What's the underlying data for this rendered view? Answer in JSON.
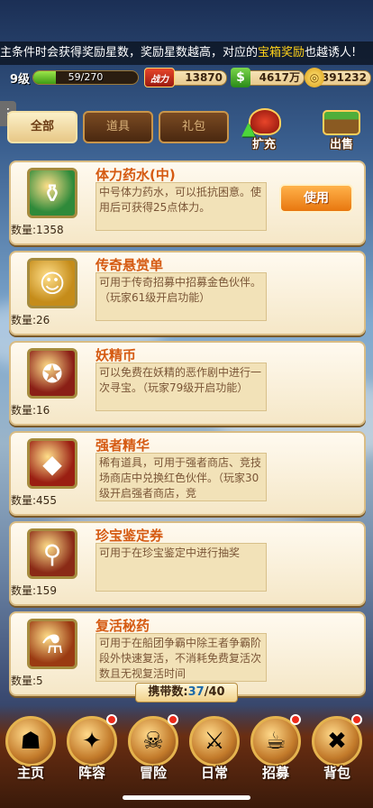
{
  "ticker": {
    "pre": "主条件时会获得奖励星数，奖励星数越高，对应的",
    "highlight": "宝箱奖励",
    "post": "也越诱人!"
  },
  "status": {
    "level": "9级",
    "xp_text": "59/270",
    "xp_fraction": 0.2185,
    "power_label": "战力",
    "power": "13870",
    "money": "4617万",
    "gold": "391232"
  },
  "side_button": {
    "icon": "menu-icon",
    "label": "⋮"
  },
  "tabs": [
    {
      "label": "全部",
      "active": true
    },
    {
      "label": "道具",
      "active": false
    },
    {
      "label": "礼包",
      "active": false
    }
  ],
  "actions": {
    "expand": "扩充",
    "sell": "出售"
  },
  "items": [
    {
      "name": "体力药水(中)",
      "desc": "中号体力药水，可以抵抗困意。使用后可获得25点体力。",
      "qty": "数量:1358",
      "icon": "potion-icon",
      "glyph": "⚱",
      "bg": "#2f8a3a",
      "button": "使用"
    },
    {
      "name": "传奇悬赏单",
      "desc": "可用于传奇招募中招募金色伙伴。（玩家61级开启功能）",
      "qty": "数量:26",
      "icon": "wanted-poster-icon",
      "glyph": "☺",
      "bg": "#c58c1a"
    },
    {
      "name": "妖精币",
      "desc": "可以免费在妖精的恶作剧中进行一次寻宝。（玩家79级开启功能）",
      "qty": "数量:16",
      "icon": "fairy-coin-icon",
      "glyph": "✪",
      "bg": "#8a1f16"
    },
    {
      "name": "强者精华",
      "desc": "稀有道具，可用于强者商店、竞技场商店中兑换红色伙伴。（玩家30级开启强者商店，竞",
      "qty": "数量:455",
      "icon": "crystal-icon",
      "glyph": "◆",
      "bg": "#9a1f12"
    },
    {
      "name": "珍宝鉴定券",
      "desc": "可用于在珍宝鉴定中进行抽奖",
      "qty": "数量:159",
      "icon": "magnifier-icon",
      "glyph": "⚲",
      "bg": "#8a2a16"
    },
    {
      "name": "复活秘药",
      "desc": "可用于在船团争霸中除王者争霸阶段外快速复活，不消耗免费复活次数且无视复活时间",
      "qty": "数量:5",
      "icon": "revive-potion-icon",
      "glyph": "⚗",
      "bg": "#9a3a12"
    }
  ],
  "carry": {
    "label": "携带数:",
    "count": "37",
    "max": "/40"
  },
  "nav": [
    {
      "label": "主页",
      "icon": "home-icon",
      "glyph": "☗",
      "badge": false
    },
    {
      "label": "阵容",
      "icon": "lineup-icon",
      "glyph": "✦",
      "badge": true
    },
    {
      "label": "冒险",
      "icon": "skull-icon",
      "glyph": "☠",
      "badge": true
    },
    {
      "label": "日常",
      "icon": "sword-icon",
      "glyph": "⚔",
      "badge": false
    },
    {
      "label": "招募",
      "icon": "tavern-icon",
      "glyph": "☕",
      "badge": true
    },
    {
      "label": "背包",
      "icon": "bag-icon",
      "glyph": "✖",
      "badge": true
    }
  ],
  "colors": {
    "accent": "#d55a12",
    "gold": "#ffd21a",
    "badge": "#ec2a1a"
  }
}
